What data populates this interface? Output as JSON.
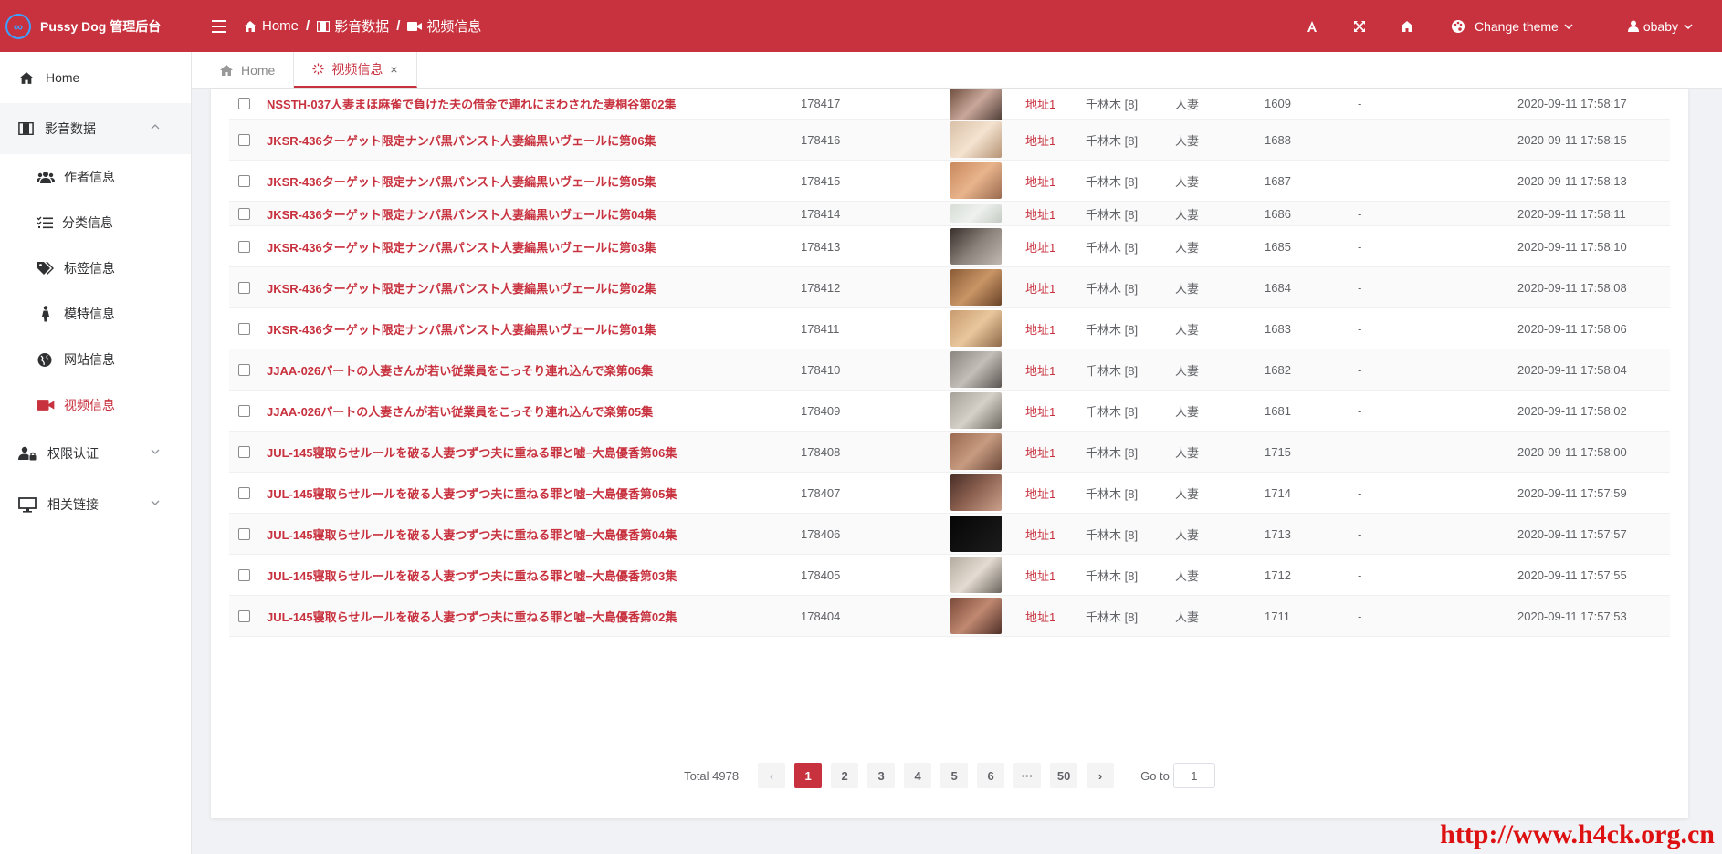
{
  "app": {
    "title": "Pussy Dog 管理后台",
    "logo_glyph": "∞"
  },
  "breadcrumb": {
    "home": "Home",
    "section": "影音数据",
    "page": "视频信息"
  },
  "header": {
    "theme_label": "Change theme",
    "user_name": "obaby",
    "icons": [
      "font-size-icon",
      "fullscreen-icon",
      "home-icon",
      "palette-icon"
    ]
  },
  "sidebar": {
    "home": "Home",
    "media_group": "影音数据",
    "media_items": [
      "作者信息",
      "分类信息",
      "标签信息",
      "模特信息",
      "网站信息",
      "视频信息"
    ],
    "auth": "权限认证",
    "links": "相关链接"
  },
  "tabs": {
    "home": "Home",
    "current": "视频信息",
    "close": "×"
  },
  "colors": {
    "accent": "#c8323f",
    "logo_ring": "#3ea0ff"
  },
  "table": {
    "rows": [
      {
        "title": "NSSTH-037人妻まほ麻雀で負けた夫の借金で連れにまわされた妻桐谷第02集",
        "id": "178417",
        "link": "地址1",
        "actor": "千林木 [8]",
        "category": "人妻",
        "num": "1609",
        "extra": "-",
        "date": "2020-09-11 17:58:17"
      },
      {
        "title": "JKSR-436ターゲット限定ナンパ黒パンスト人妻編黒いヴェールに第06集",
        "id": "178416",
        "link": "地址1",
        "actor": "千林木 [8]",
        "category": "人妻",
        "num": "1688",
        "extra": "-",
        "date": "2020-09-11 17:58:15"
      },
      {
        "title": "JKSR-436ターゲット限定ナンパ黒パンスト人妻編黒いヴェールに第05集",
        "id": "178415",
        "link": "地址1",
        "actor": "千林木 [8]",
        "category": "人妻",
        "num": "1687",
        "extra": "-",
        "date": "2020-09-11 17:58:13"
      },
      {
        "title": "JKSR-436ターゲット限定ナンパ黒パンスト人妻編黒いヴェールに第04集",
        "id": "178414",
        "link": "地址1",
        "actor": "千林木 [8]",
        "category": "人妻",
        "num": "1686",
        "extra": "-",
        "date": "2020-09-11 17:58:11"
      },
      {
        "title": "JKSR-436ターゲット限定ナンパ黒パンスト人妻編黒いヴェールに第03集",
        "id": "178413",
        "link": "地址1",
        "actor": "千林木 [8]",
        "category": "人妻",
        "num": "1685",
        "extra": "-",
        "date": "2020-09-11 17:58:10"
      },
      {
        "title": "JKSR-436ターゲット限定ナンパ黒パンスト人妻編黒いヴェールに第02集",
        "id": "178412",
        "link": "地址1",
        "actor": "千林木 [8]",
        "category": "人妻",
        "num": "1684",
        "extra": "-",
        "date": "2020-09-11 17:58:08"
      },
      {
        "title": "JKSR-436ターゲット限定ナンパ黒パンスト人妻編黒いヴェールに第01集",
        "id": "178411",
        "link": "地址1",
        "actor": "千林木 [8]",
        "category": "人妻",
        "num": "1683",
        "extra": "-",
        "date": "2020-09-11 17:58:06"
      },
      {
        "title": "JJAA-026パートの人妻さんが若い従業員をこっそり連れ込んで楽第06集",
        "id": "178410",
        "link": "地址1",
        "actor": "千林木 [8]",
        "category": "人妻",
        "num": "1682",
        "extra": "-",
        "date": "2020-09-11 17:58:04"
      },
      {
        "title": "JJAA-026パートの人妻さんが若い従業員をこっそり連れ込んで楽第05集",
        "id": "178409",
        "link": "地址1",
        "actor": "千林木 [8]",
        "category": "人妻",
        "num": "1681",
        "extra": "-",
        "date": "2020-09-11 17:58:02"
      },
      {
        "title": "JUL-145寝取らせルールを破る人妻つずつ夫に重ねる罪と嘘−大島優香第06集",
        "id": "178408",
        "link": "地址1",
        "actor": "千林木 [8]",
        "category": "人妻",
        "num": "1715",
        "extra": "-",
        "date": "2020-09-11 17:58:00"
      },
      {
        "title": "JUL-145寝取らせルールを破る人妻つずつ夫に重ねる罪と嘘−大島優香第05集",
        "id": "178407",
        "link": "地址1",
        "actor": "千林木 [8]",
        "category": "人妻",
        "num": "1714",
        "extra": "-",
        "date": "2020-09-11 17:57:59"
      },
      {
        "title": "JUL-145寝取らせルールを破る人妻つずつ夫に重ねる罪と嘘−大島優香第04集",
        "id": "178406",
        "link": "地址1",
        "actor": "千林木 [8]",
        "category": "人妻",
        "num": "1713",
        "extra": "-",
        "date": "2020-09-11 17:57:57"
      },
      {
        "title": "JUL-145寝取らせルールを破る人妻つずつ夫に重ねる罪と嘘−大島優香第03集",
        "id": "178405",
        "link": "地址1",
        "actor": "千林木 [8]",
        "category": "人妻",
        "num": "1712",
        "extra": "-",
        "date": "2020-09-11 17:57:55"
      },
      {
        "title": "JUL-145寝取らせルールを破る人妻つずつ夫に重ねる罪と嘘−大島優香第02集",
        "id": "178404",
        "link": "地址1",
        "actor": "千林木 [8]",
        "category": "人妻",
        "num": "1711",
        "extra": "-",
        "date": "2020-09-11 17:57:53"
      }
    ]
  },
  "pagination": {
    "total_label": "Total 4978",
    "prev": "‹",
    "next": "›",
    "pages": [
      "1",
      "2",
      "3",
      "4",
      "5",
      "6",
      "···",
      "50"
    ],
    "current": "1",
    "goto_label": "Go to",
    "goto_value": "1"
  },
  "watermark": "http://www.h4ck.org.cn"
}
